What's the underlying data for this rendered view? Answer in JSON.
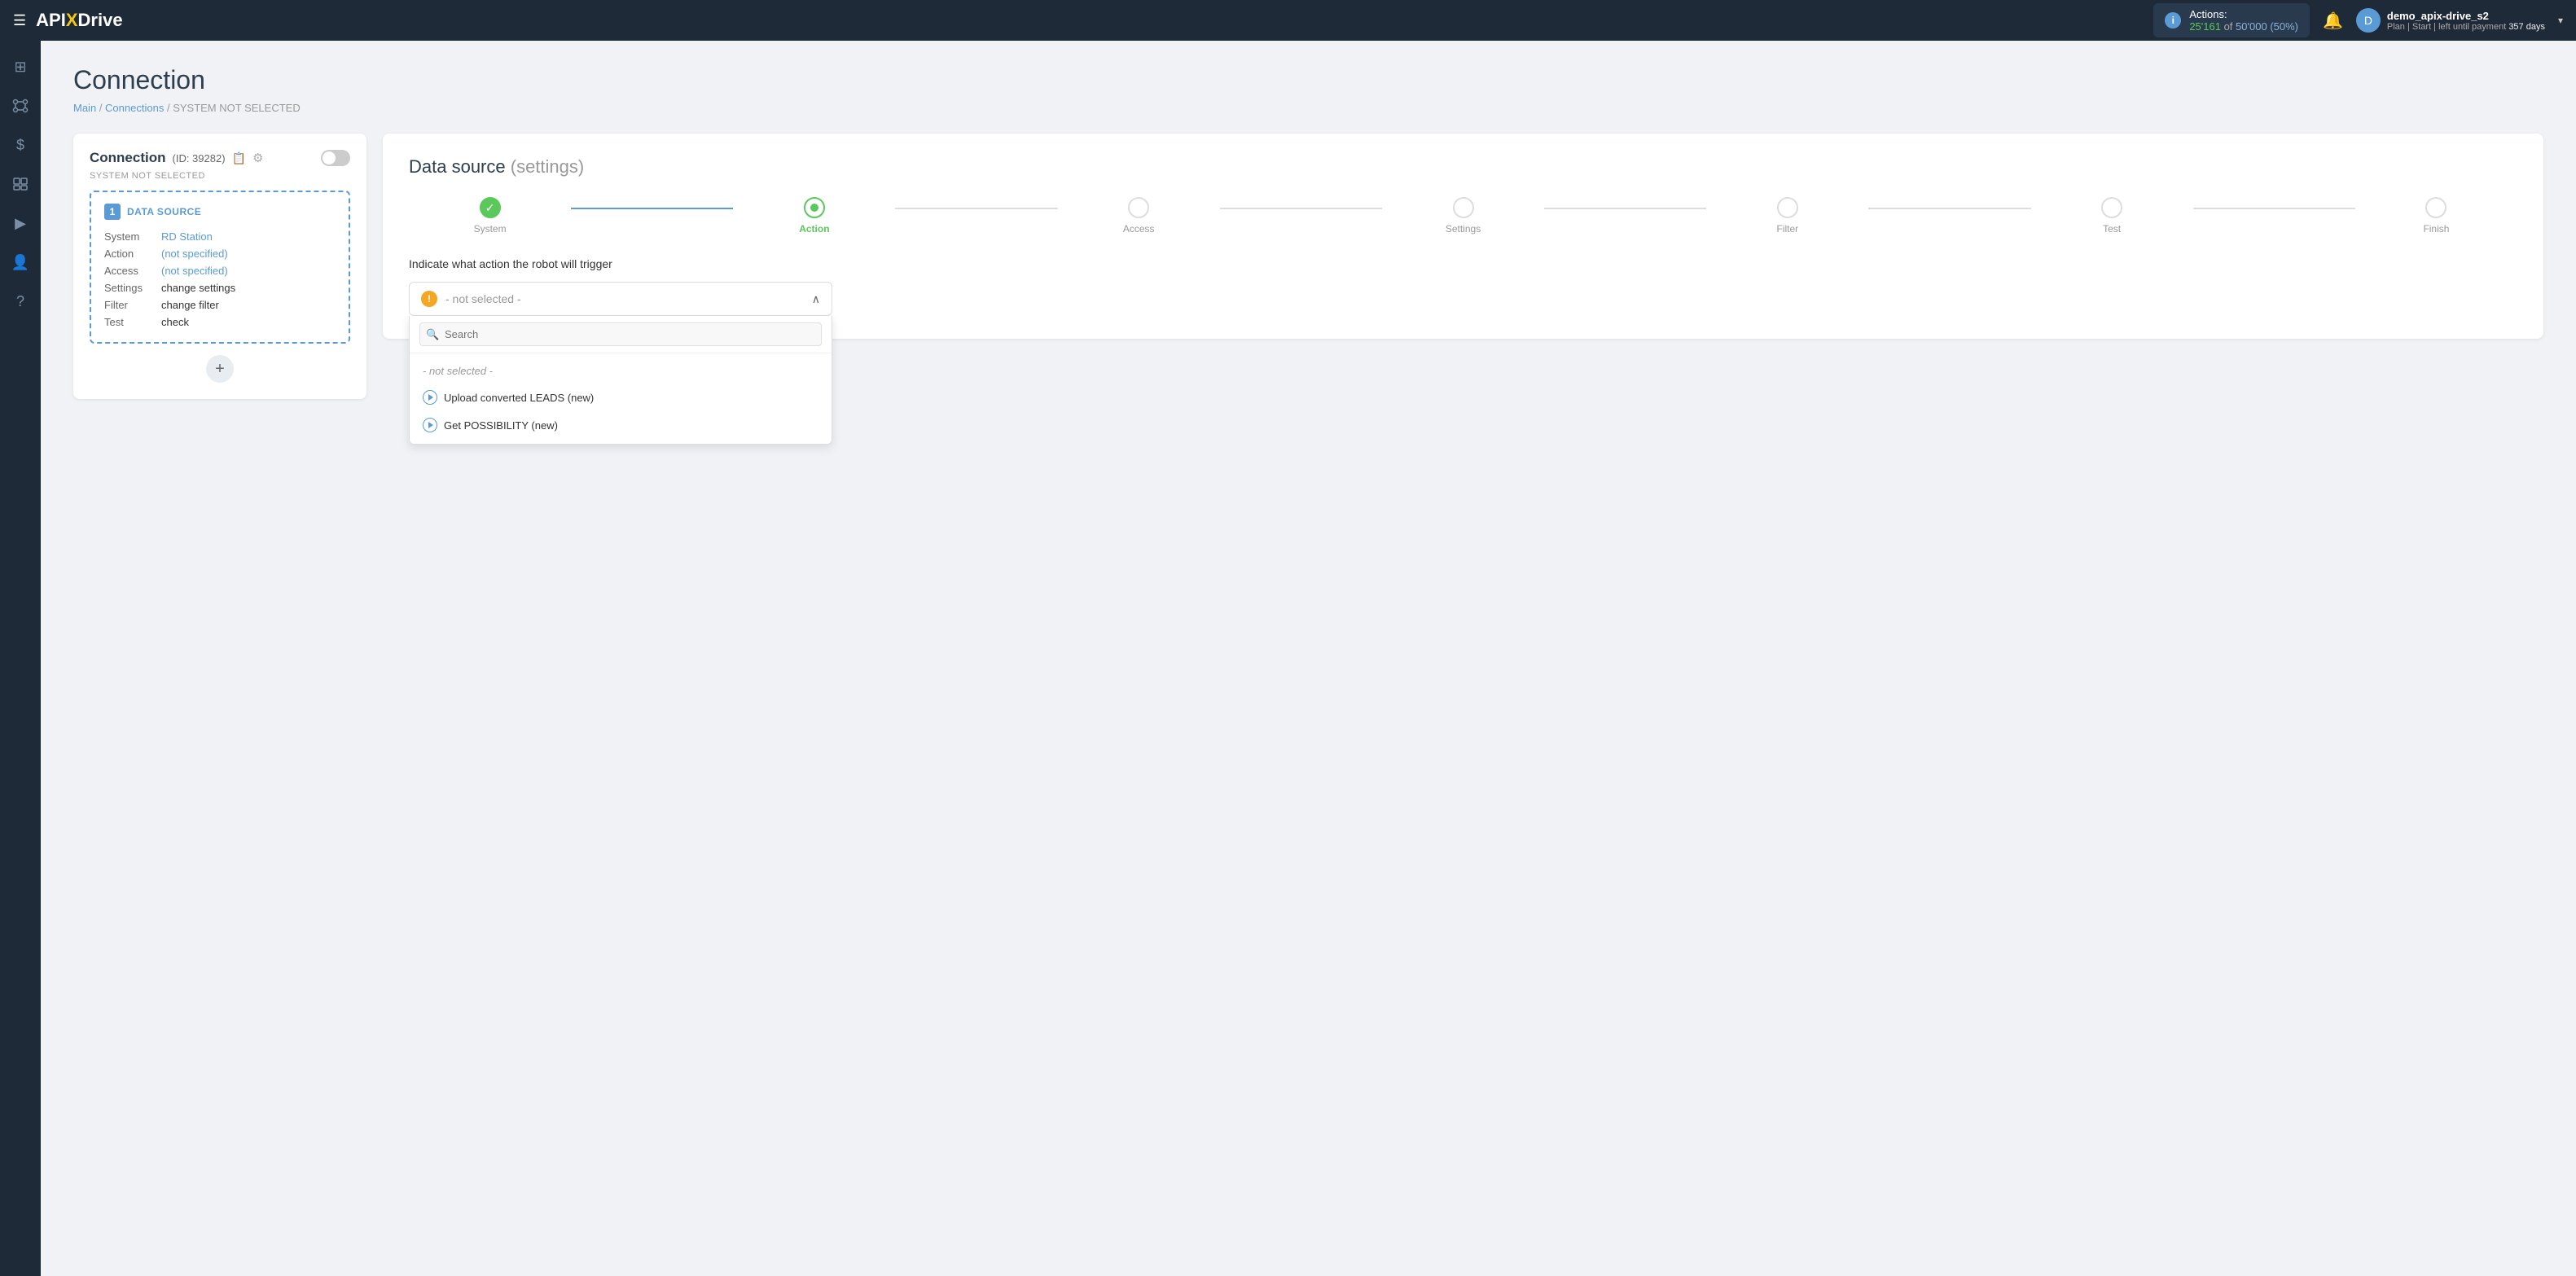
{
  "navbar": {
    "menu_label": "☰",
    "logo_text_1": "API",
    "logo_x": "X",
    "logo_text_2": "Drive",
    "actions_label": "Actions:",
    "actions_count": "25'161",
    "actions_of": "of",
    "actions_total": "50'000",
    "actions_pct": "(50%)",
    "bell_icon": "🔔",
    "user_avatar_letter": "D",
    "user_name": "demo_apix-drive_s2",
    "user_plan_label": "Plan | Start | left until payment",
    "user_plan_days": "357 days",
    "chevron": "▾"
  },
  "sidebar": {
    "items": [
      {
        "icon": "⊞",
        "label": "dashboard"
      },
      {
        "icon": "⋮⋮",
        "label": "connections"
      },
      {
        "icon": "$",
        "label": "billing"
      },
      {
        "icon": "💼",
        "label": "workspace"
      },
      {
        "icon": "▶",
        "label": "tutorials"
      },
      {
        "icon": "👤",
        "label": "profile"
      },
      {
        "icon": "?",
        "label": "help"
      }
    ]
  },
  "page": {
    "title": "Connection",
    "breadcrumb": {
      "main": "Main",
      "connections": "Connections",
      "current": "SYSTEM NOT SELECTED"
    }
  },
  "connection_card": {
    "title": "Connection",
    "id_label": "(ID: 39282)",
    "system_not_selected": "SYSTEM NOT SELECTED",
    "data_source_number": "1",
    "data_source_title": "DATA SOURCE",
    "rows": [
      {
        "label": "System",
        "value": "RD Station",
        "style": "blue"
      },
      {
        "label": "Action",
        "value": "(not specified)",
        "style": "blue"
      },
      {
        "label": "Access",
        "value": "(not specified)",
        "style": "blue"
      },
      {
        "label": "Settings",
        "value": "change settings",
        "style": "black"
      },
      {
        "label": "Filter",
        "value": "change filter",
        "style": "black"
      },
      {
        "label": "Test",
        "value": "check",
        "style": "black"
      }
    ],
    "add_btn": "+"
  },
  "ds_settings": {
    "title": "Data source",
    "title_parens": "(settings)",
    "steps": [
      {
        "label": "System",
        "state": "done"
      },
      {
        "label": "Action",
        "state": "active"
      },
      {
        "label": "Access",
        "state": "inactive"
      },
      {
        "label": "Settings",
        "state": "inactive"
      },
      {
        "label": "Filter",
        "state": "inactive"
      },
      {
        "label": "Test",
        "state": "inactive"
      },
      {
        "label": "Finish",
        "state": "inactive"
      }
    ],
    "instruction": "Indicate what action the robot will trigger",
    "dropdown": {
      "selected": "- not selected -",
      "search_placeholder": "Search",
      "items": [
        {
          "type": "not-selected",
          "text": "- not selected -"
        },
        {
          "type": "option",
          "text": "Upload converted LEADS (new)"
        },
        {
          "type": "option",
          "text": "Get POSSIBILITY (new)"
        }
      ]
    }
  }
}
